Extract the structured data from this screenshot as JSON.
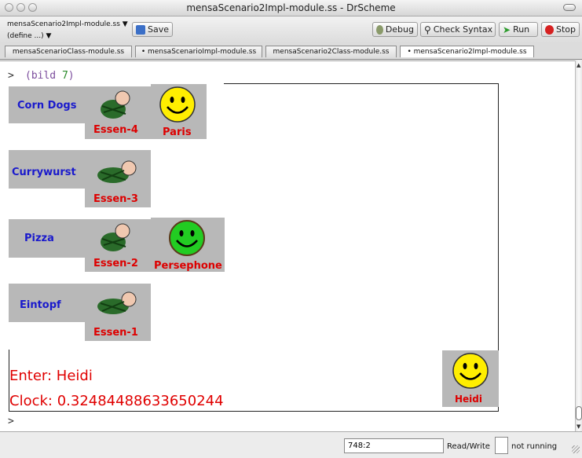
{
  "window": {
    "title": "mensaScenario2Impl-module.ss - DrScheme"
  },
  "toolbar": {
    "module_name": "mensaScenario2Impl-module.ss",
    "define_menu": "(define ...)",
    "save": "Save",
    "debug": "Debug",
    "check_syntax": "Check Syntax",
    "run": "Run",
    "stop": "Stop"
  },
  "tabs": [
    {
      "label": "mensaScenarioClass-module.ss",
      "active": false
    },
    {
      "label": "• mensaScenarioImpl-module.ss",
      "active": false
    },
    {
      "label": "mensaScenario2Class-module.ss",
      "active": false
    },
    {
      "label": "• mensaScenario2Impl-module.ss",
      "active": true
    }
  ],
  "repl": {
    "prompt": ">",
    "expr_open": "(bild ",
    "expr_num": "7",
    "expr_close": ")",
    "prompt2": ">"
  },
  "scene": {
    "stations": [
      {
        "food": "Corn Dogs",
        "essen": "Essen-4",
        "person": "Paris",
        "face": "yellow"
      },
      {
        "food": "Currywurst",
        "essen": "Essen-3",
        "person": "",
        "face": ""
      },
      {
        "food": "Pizza",
        "essen": "Essen-2",
        "person": "Persephone",
        "face": "green"
      },
      {
        "food": "Eintopf",
        "essen": "Essen-1",
        "person": "",
        "face": ""
      }
    ],
    "entering": {
      "person": "Heidi",
      "face": "yellow"
    },
    "enter_text": "Enter: Heidi",
    "clock_text": "Clock: 0.32484488633650244"
  },
  "status": {
    "position": "748:2",
    "read_write": "Read/Write",
    "running": "not running"
  },
  "colors": {
    "food_label": "#1a1acc",
    "red_label": "#dd0000",
    "face_yellow": "#ffee00",
    "face_green": "#22cc22"
  }
}
